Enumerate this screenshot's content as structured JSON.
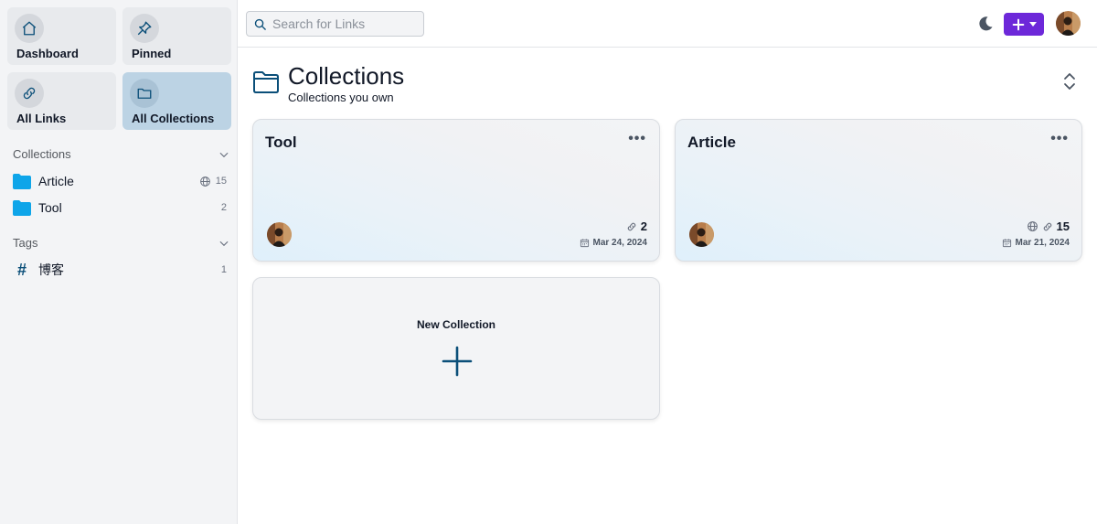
{
  "sidebar": {
    "nav": [
      {
        "label": "Dashboard",
        "icon": "home-icon"
      },
      {
        "label": "Pinned",
        "icon": "pin-icon"
      },
      {
        "label": "All Links",
        "icon": "link-icon"
      },
      {
        "label": "All Collections",
        "icon": "folder-icon",
        "active": true
      }
    ],
    "collections_heading": "Collections",
    "collections": [
      {
        "label": "Article",
        "count": "15",
        "public": true
      },
      {
        "label": "Tool",
        "count": "2",
        "public": false
      }
    ],
    "tags_heading": "Tags",
    "tags": [
      {
        "label": "博客",
        "count": "1"
      }
    ]
  },
  "topbar": {
    "search_placeholder": "Search for Links"
  },
  "main": {
    "title": "Collections",
    "subtitle": "Collections you own",
    "cards": [
      {
        "title": "Tool",
        "links": "2",
        "date": "Mar 24, 2024",
        "public": false
      },
      {
        "title": "Article",
        "links": "15",
        "date": "Mar 21, 2024",
        "public": true
      }
    ],
    "new_collection_label": "New Collection"
  },
  "colors": {
    "accent": "#6d28d9",
    "folder": "#0ea5e9",
    "active_nav": "#bcd3e4",
    "icon_dark": "#0b4f79"
  }
}
